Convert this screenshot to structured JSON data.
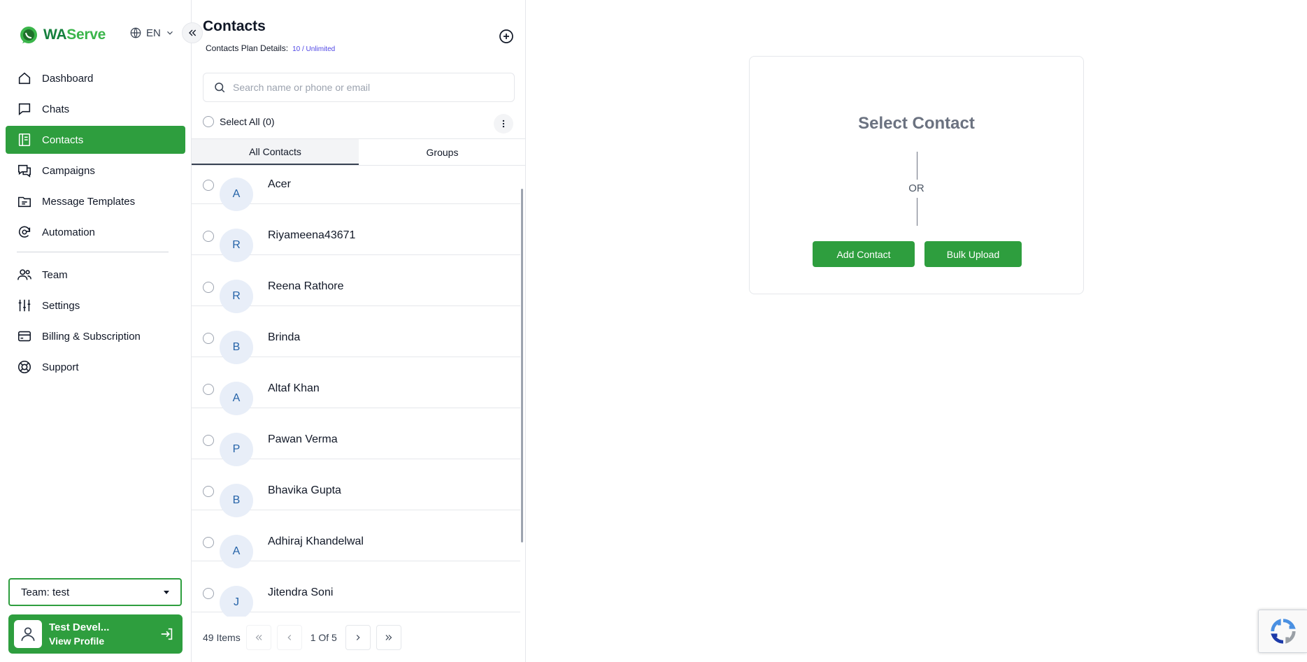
{
  "brand": {
    "wa": "WA",
    "serve": "Serve"
  },
  "language": {
    "selected": "EN"
  },
  "sidebar": {
    "items": [
      {
        "label": "Dashboard",
        "icon": "home-icon",
        "active": false
      },
      {
        "label": "Chats",
        "icon": "chat-icon",
        "active": false
      },
      {
        "label": "Contacts",
        "icon": "contacts-icon",
        "active": true
      },
      {
        "label": "Campaigns",
        "icon": "campaigns-icon",
        "active": false
      },
      {
        "label": "Message Templates",
        "icon": "template-icon",
        "active": false
      },
      {
        "label": "Automation",
        "icon": "automation-icon",
        "active": false
      },
      {
        "label": "Team",
        "icon": "team-icon",
        "active": false
      },
      {
        "label": "Settings",
        "icon": "sliders-icon",
        "active": false
      },
      {
        "label": "Billing & Subscription",
        "icon": "credit-card-icon",
        "active": false
      },
      {
        "label": "Support",
        "icon": "lifebuoy-icon",
        "active": false
      }
    ],
    "team_select": "Team: test",
    "profile": {
      "name": "Test Devel...",
      "link": "View Profile"
    }
  },
  "contacts": {
    "title": "Contacts",
    "plan_label": "Contacts Plan Details:",
    "plan_value": "10 / Unlimited",
    "search_placeholder": "Search name or phone or email",
    "select_all": "Select All (0)",
    "tabs": [
      {
        "label": "All Contacts",
        "active": true
      },
      {
        "label": "Groups",
        "active": false
      }
    ],
    "list": [
      {
        "initial": "A",
        "name": "Acer"
      },
      {
        "initial": "R",
        "name": "Riyameena43671"
      },
      {
        "initial": "R",
        "name": "Reena Rathore"
      },
      {
        "initial": "B",
        "name": "Brinda"
      },
      {
        "initial": "A",
        "name": "Altaf Khan"
      },
      {
        "initial": "P",
        "name": "Pawan Verma"
      },
      {
        "initial": "B",
        "name": "Bhavika Gupta"
      },
      {
        "initial": "A",
        "name": "Adhiraj Khandelwal"
      },
      {
        "initial": "J",
        "name": "Jitendra Soni"
      }
    ],
    "pager": {
      "items": "49 Items",
      "page": "1 Of 5"
    }
  },
  "main": {
    "title": "Select Contact",
    "or": "OR",
    "add_contact": "Add Contact",
    "bulk_upload": "Bulk Upload"
  },
  "colors": {
    "accent": "#2e9e3e",
    "avatar_bg": "#e8eef8",
    "avatar_text": "#2563a8",
    "plan_value": "#4f46e5"
  }
}
